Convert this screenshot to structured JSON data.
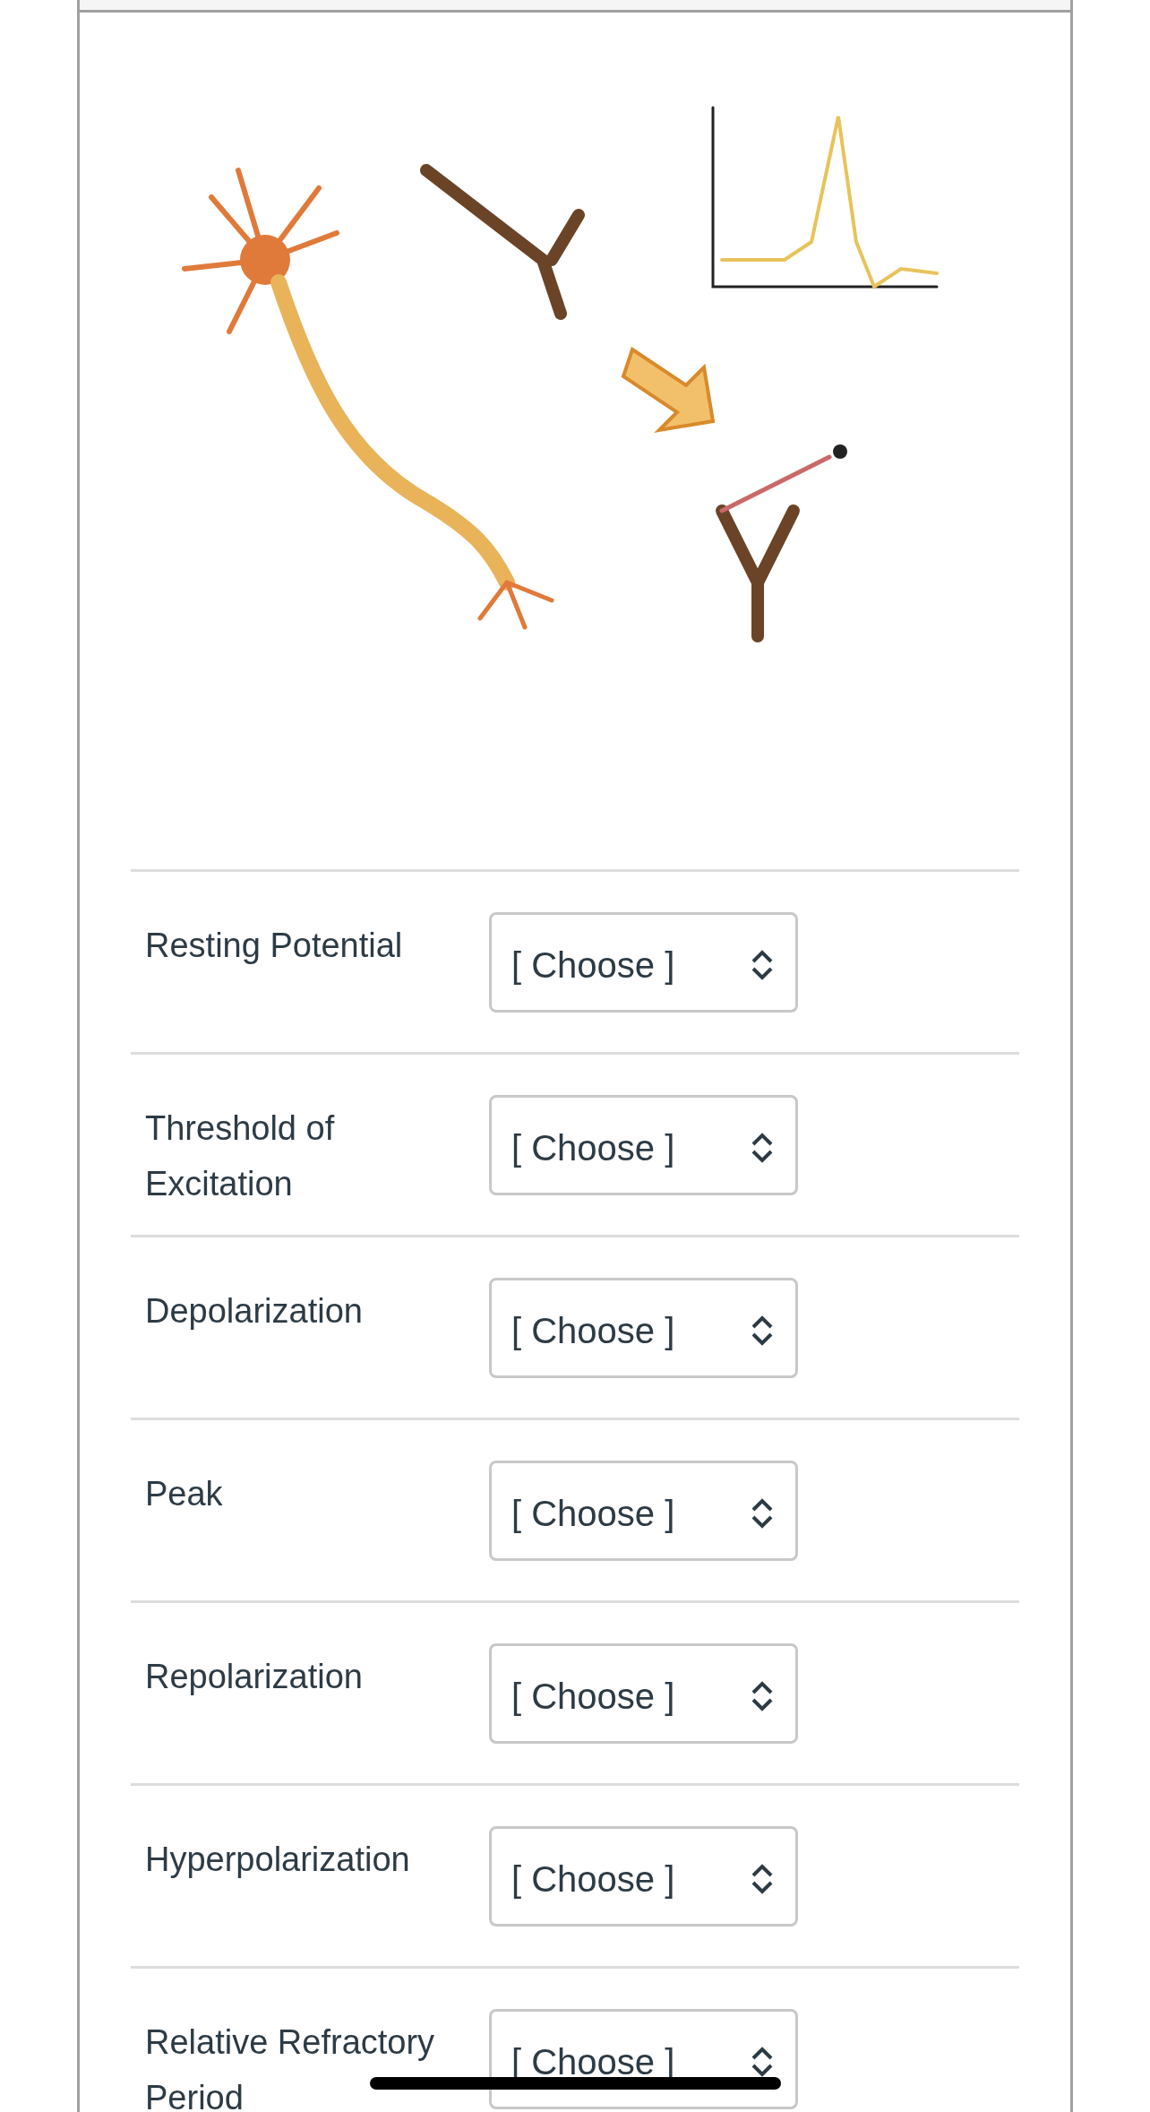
{
  "questions": [
    {
      "label": "Resting Potential",
      "select": {
        "value": "[ Choose ]"
      }
    },
    {
      "label": "Threshold of Excitation",
      "select": {
        "value": "[ Choose ]"
      }
    },
    {
      "label": "Depolarization",
      "select": {
        "value": "[ Choose ]"
      }
    },
    {
      "label": "Peak",
      "select": {
        "value": "[ Choose ]"
      }
    },
    {
      "label": "Repolarization",
      "select": {
        "value": "[ Choose ]"
      }
    },
    {
      "label": "Hyperpolarization",
      "select": {
        "value": "[ Choose ]"
      }
    },
    {
      "label": "Relative Refractory Period",
      "select": {
        "value": "[ Choose ]"
      }
    }
  ]
}
